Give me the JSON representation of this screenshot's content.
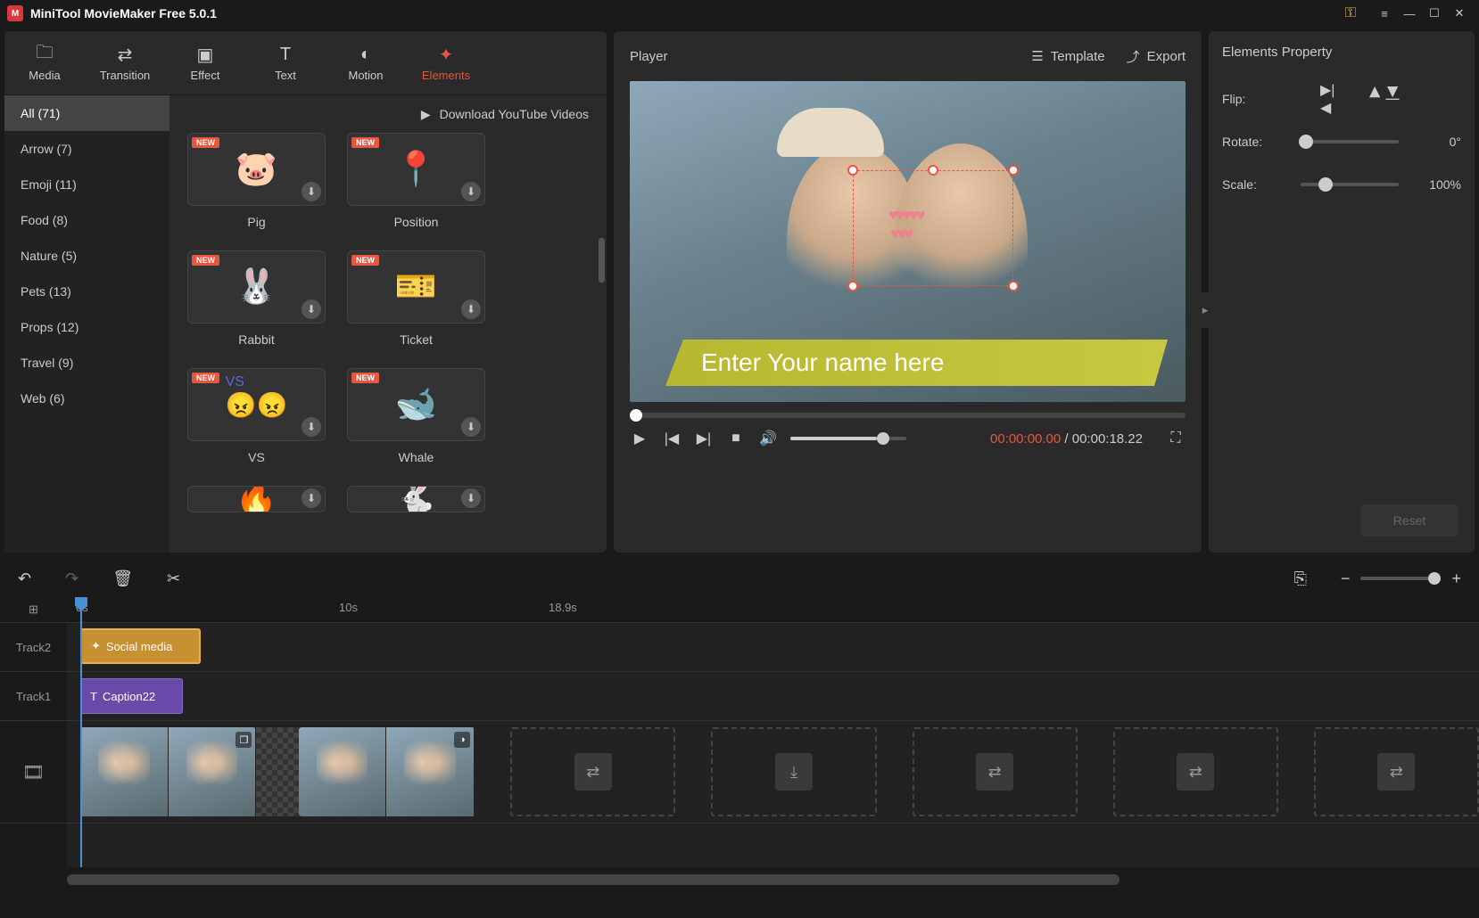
{
  "app": {
    "title": "MiniTool MovieMaker Free 5.0.1"
  },
  "toolbar": {
    "tabs": [
      {
        "label": "Media",
        "icon": "folder-icon"
      },
      {
        "label": "Transition",
        "icon": "swap-icon"
      },
      {
        "label": "Effect",
        "icon": "sparkle-icon"
      },
      {
        "label": "Text",
        "icon": "text-icon"
      },
      {
        "label": "Motion",
        "icon": "motion-icon"
      },
      {
        "label": "Elements",
        "icon": "elements-icon"
      }
    ],
    "active": 5
  },
  "categories": [
    "All (71)",
    "Arrow (7)",
    "Emoji (11)",
    "Food (8)",
    "Nature (5)",
    "Pets (13)",
    "Props (12)",
    "Travel (9)",
    "Web (6)"
  ],
  "download_bar": "Download YouTube Videos",
  "elements": [
    {
      "name": "Pig",
      "emoji": "🐷",
      "new": true
    },
    {
      "name": "Position",
      "emoji": "📍",
      "new": true
    },
    {
      "name": "Rabbit",
      "emoji": "🐰",
      "new": true
    },
    {
      "name": "Ticket",
      "emoji": "🎫",
      "new": true
    },
    {
      "name": "VS",
      "emoji": "😠😠",
      "new": true,
      "vs": true
    },
    {
      "name": "Whale",
      "emoji": "🐋",
      "new": true
    },
    {
      "name": "",
      "emoji": "🔥",
      "new": false
    },
    {
      "name": "",
      "emoji": "🐇",
      "new": false
    }
  ],
  "player": {
    "title": "Player",
    "template_btn": "Template",
    "export_btn": "Export",
    "caption_text": "Enter Your name here",
    "time_current": "00:00:00.00",
    "time_total": "00:00:18.22"
  },
  "properties": {
    "title": "Elements Property",
    "flip_label": "Flip:",
    "rotate_label": "Rotate:",
    "rotate_value": "0°",
    "scale_label": "Scale:",
    "scale_value": "100%",
    "reset_btn": "Reset"
  },
  "timeline": {
    "ruler": {
      "t0": "0s",
      "t1": "10s",
      "t2": "18.9s"
    },
    "tracks": {
      "track2": {
        "label": "Track2",
        "clip": "Social media"
      },
      "track1": {
        "label": "Track1",
        "clip": "Caption22"
      }
    }
  }
}
